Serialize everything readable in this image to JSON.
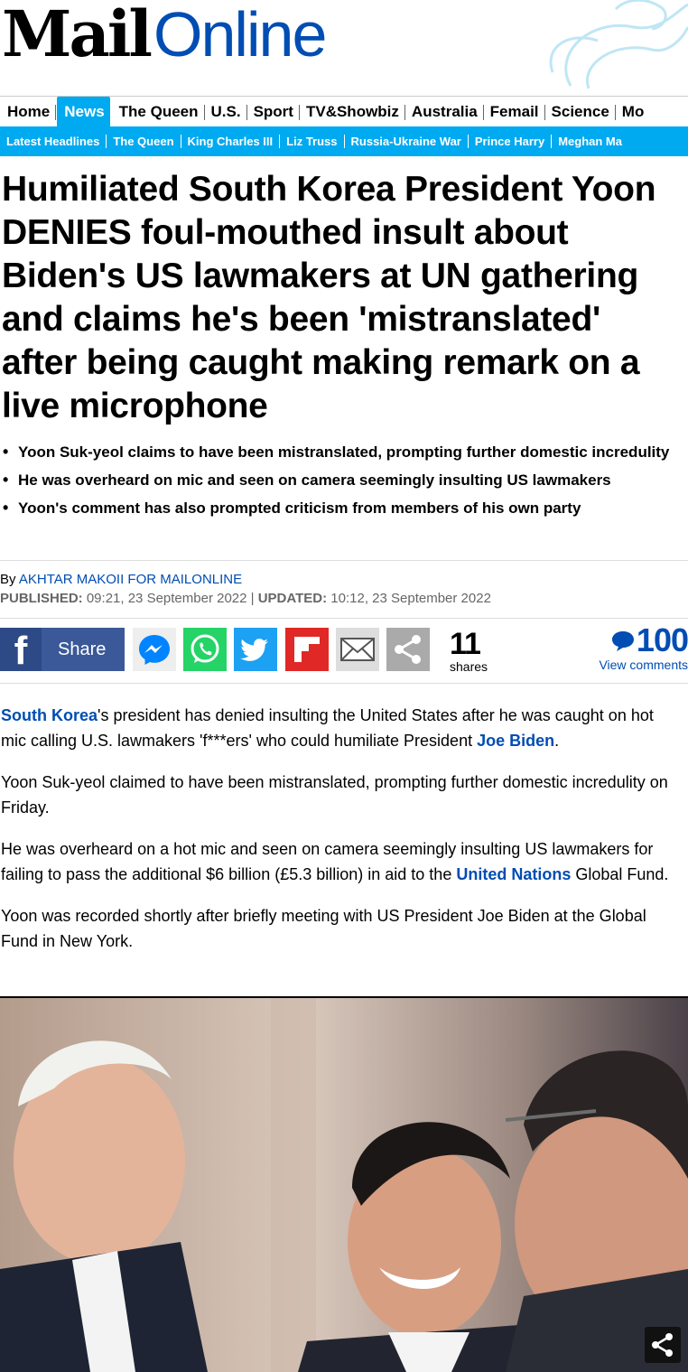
{
  "masthead": {
    "logo_mail": "Mail",
    "logo_online": "Online",
    "brand_color": "#004db3"
  },
  "nav": {
    "primary": [
      "Home",
      "News",
      "The Queen",
      "U.S.",
      "Sport",
      "TV&Showbiz",
      "Australia",
      "Femail",
      "Science",
      "Mo"
    ],
    "active_index": 1,
    "active_color": "#00aaf0",
    "secondary": [
      "Latest Headlines",
      "The Queen",
      "King Charles III",
      "Liz Truss",
      "Russia-Ukraine War",
      "Prince Harry",
      "Meghan Ma"
    ]
  },
  "article": {
    "headline": "Humiliated South Korea President Yoon DENIES foul-mouthed insult about Biden's US lawmakers at UN gathering and claims he's been 'mistranslated' after being caught making remark on a live microphone",
    "bullets": [
      "Yoon Suk-yeol claims to have been mistranslated, prompting further domestic incredulity",
      "He was overheard on mic and seen on camera seemingly insulting US lawmakers",
      "Yoon's comment has also prompted criticism from members of his own party"
    ],
    "byline_prefix": "By ",
    "author": "AKHTAR MAKOII FOR MAILONLINE",
    "published_label": "PUBLISHED:",
    "published": " 09:21, 23 September 2022 | ",
    "updated_label": "UPDATED:",
    "updated": " 10:12, 23 September 2022",
    "paragraphs": [
      {
        "link1": "South Korea",
        "text1": "'s president has denied insulting the United States after he was caught on hot mic calling U.S. lawmakers 'f***ers' who could humiliate President ",
        "link2": "Joe Biden",
        "text2": "."
      },
      {
        "text": "Yoon Suk-yeol claimed to have been mistranslated, prompting further domestic incredulity on Friday."
      },
      {
        "text1": "He was overheard on a hot mic and seen on camera seemingly insulting US lawmakers for failing to pass the additional $6 billion (£5.3 billion) in aid to the ",
        "link": "United Nations",
        "text2": " Global Fund."
      },
      {
        "text": "Yoon was recorded shortly after briefly meeting with US President Joe Biden at the Global Fund in New York."
      }
    ]
  },
  "share": {
    "facebook_label": "Share",
    "share_count": "11",
    "shares_label": "shares",
    "comment_count": "100",
    "comments_label": "View comments",
    "icons": [
      "facebook-icon",
      "messenger-icon",
      "whatsapp-icon",
      "twitter-icon",
      "flipboard-icon",
      "email-icon",
      "share-icon"
    ]
  }
}
